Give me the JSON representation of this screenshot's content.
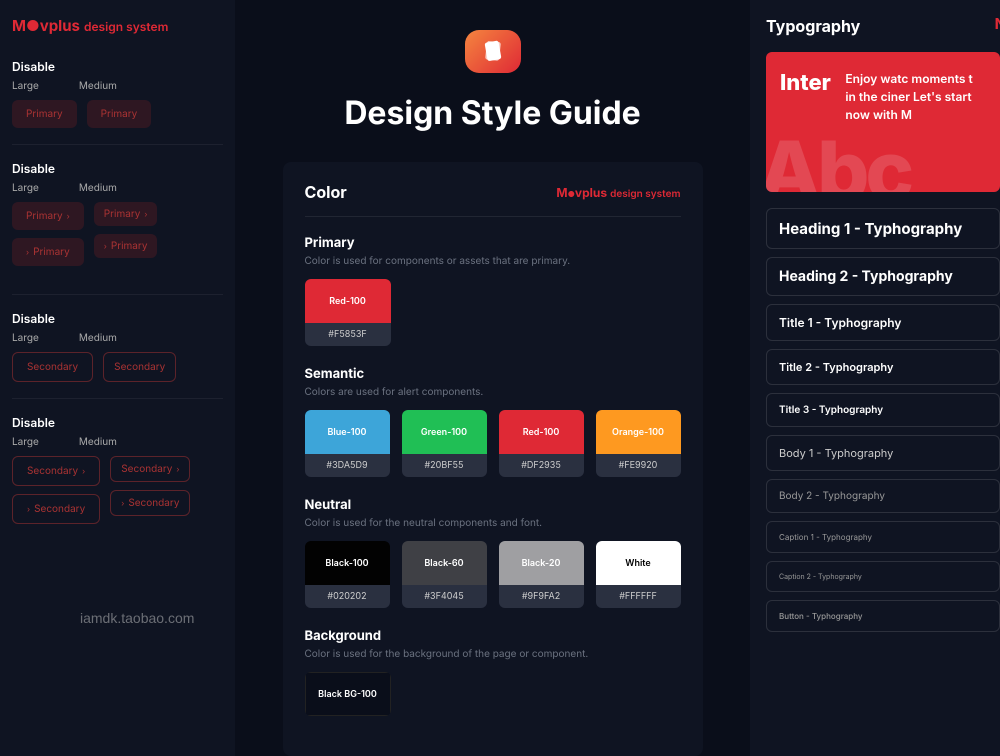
{
  "brand": {
    "name": "Movplus",
    "sub": "design system"
  },
  "mainTitle": "Design Style Guide",
  "watermark": "iamdk.taobao.com",
  "left": {
    "sections": [
      {
        "label": "Disable",
        "large": "Large",
        "medium": "Medium"
      },
      {
        "label": "Disable",
        "large": "Large",
        "medium": "Medium"
      },
      {
        "label": "Disable",
        "large": "Large",
        "medium": "Medium"
      },
      {
        "label": "Disable",
        "large": "Large",
        "medium": "Medium"
      }
    ],
    "btnPrimary": "Primary",
    "btnSecondary": "Secondary"
  },
  "colorCard": {
    "title": "Color",
    "primary": {
      "title": "Primary",
      "desc": "Color is used for components or assets that are primary.",
      "swatches": [
        {
          "name": "Red-100",
          "hex": "#F5853F",
          "bg": "#DF2935",
          "fg": "#fff"
        }
      ]
    },
    "semantic": {
      "title": "Semantic",
      "desc": "Colors are used for alert components.",
      "swatches": [
        {
          "name": "Blue-100",
          "hex": "#3DA5D9",
          "bg": "#3DA5D9",
          "fg": "#fff"
        },
        {
          "name": "Green-100",
          "hex": "#20BF55",
          "bg": "#20BF55",
          "fg": "#fff"
        },
        {
          "name": "Red-100",
          "hex": "#DF2935",
          "bg": "#DF2935",
          "fg": "#fff"
        },
        {
          "name": "Orange-100",
          "hex": "#FE9920",
          "bg": "#FE9920",
          "fg": "#fff"
        }
      ]
    },
    "neutral": {
      "title": "Neutral",
      "desc": "Color is used for the neutral components and font.",
      "swatches": [
        {
          "name": "Black-100",
          "hex": "#020202",
          "bg": "#020202",
          "fg": "#fff"
        },
        {
          "name": "Black-60",
          "hex": "#3F4045",
          "bg": "#3F4045",
          "fg": "#fff"
        },
        {
          "name": "Black-20",
          "hex": "#9F9FA2",
          "bg": "#9F9FA2",
          "fg": "#fff"
        },
        {
          "name": "White",
          "hex": "#FFFFFF",
          "bg": "#FFFFFF",
          "fg": "#000"
        }
      ]
    },
    "background": {
      "title": "Background",
      "desc": "Color is used for the background of the page or component.",
      "swatches": [
        {
          "name": "Black BG-100",
          "hex": "",
          "bg": "#0a0e1a",
          "fg": "#fff"
        }
      ]
    }
  },
  "typography": {
    "title": "Typography",
    "fontName": "Inter",
    "tagline": "Enjoy watc moments t in the ciner Let's start now with M",
    "abc": "Abc",
    "items": [
      "Heading 1 - Typhography",
      "Heading 2 - Typhography",
      "Title 1 - Typhography",
      "Title 2 - Typhography",
      "Title 3 - Typhography",
      "Body 1 - Typhography",
      "Body 2 - Typhography",
      "Caption 1 - Typhography",
      "Caption 2 - Typhography",
      "Button - Typhography"
    ]
  }
}
